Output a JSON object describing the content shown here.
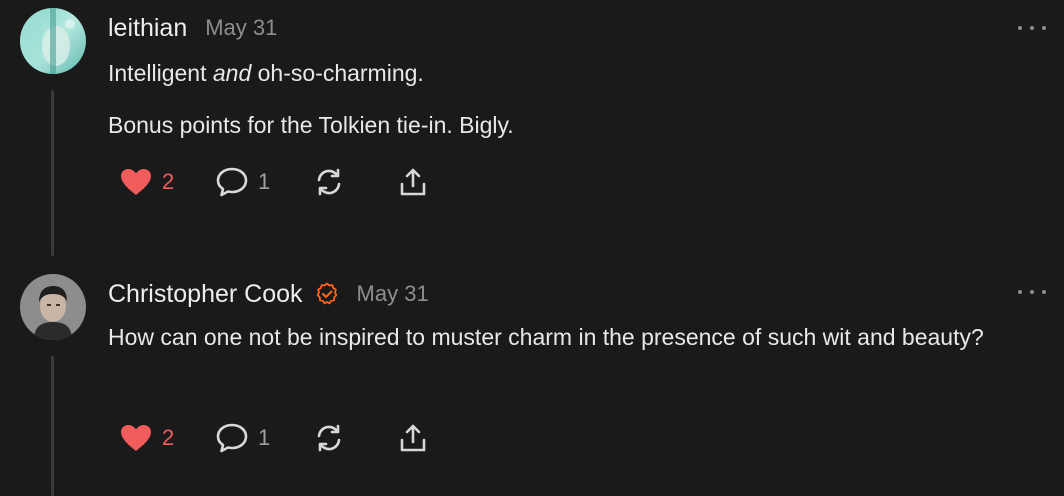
{
  "comments": [
    {
      "author": "leithian",
      "date": "May 31",
      "paragraphs": [
        {
          "before": "Intelligent ",
          "emphasis": "and",
          "after": " oh-so-charming."
        },
        {
          "text": "Bonus points for the Tolkien tie-in. Bigly."
        }
      ],
      "likes": "2",
      "replies": "1",
      "avatar_icon": "avatar-image",
      "like_icon": "heart-icon",
      "reply_icon": "comment-bubble-icon",
      "restack_icon": "restack-icon",
      "share_icon": "share-icon"
    },
    {
      "author": "Christopher Cook",
      "verified": true,
      "date": "May 31",
      "text": "How can one not be inspired to muster charm in the presence of such wit and beauty?",
      "likes": "2",
      "replies": "1",
      "avatar_icon": "avatar-image",
      "like_icon": "heart-icon",
      "reply_icon": "comment-bubble-icon",
      "restack_icon": "restack-icon",
      "share_icon": "share-icon"
    }
  ],
  "colors": {
    "background": "#1a1a1b",
    "like": "#f25c5c",
    "verified": "#ff6719",
    "muted": "#8e8e90",
    "thread_line": "#3a3a3c"
  }
}
